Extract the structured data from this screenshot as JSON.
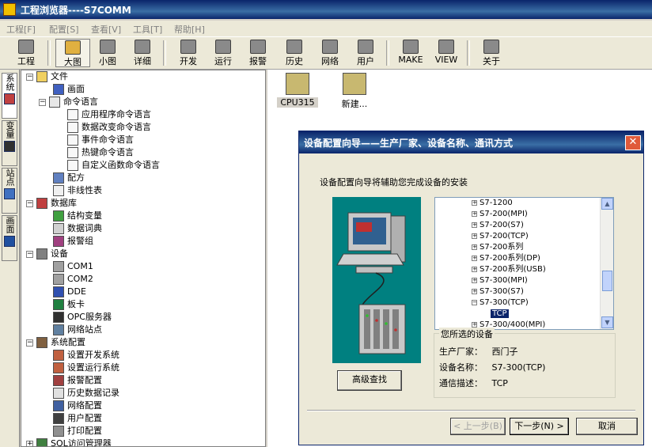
{
  "app": {
    "title": "工程浏览器----S7COMM"
  },
  "menu": [
    "工程[F]",
    "配置[S]",
    "查看[V]",
    "工具[T]",
    "帮助[H]"
  ],
  "toolbar": {
    "items": [
      {
        "label": "工程",
        "icon": "project-icon"
      },
      {
        "label": "大图",
        "icon": "large-icons-icon"
      },
      {
        "label": "小图",
        "icon": "small-icons-icon"
      },
      {
        "label": "详细",
        "icon": "details-icon"
      },
      {
        "label": "开发",
        "icon": "develop-icon"
      },
      {
        "label": "运行",
        "icon": "run-icon"
      },
      {
        "label": "报警",
        "icon": "alarm-icon"
      },
      {
        "label": "历史",
        "icon": "history-icon"
      },
      {
        "label": "网络",
        "icon": "network-icon"
      },
      {
        "label": "用户",
        "icon": "user-icon"
      },
      {
        "label": "MAKE",
        "icon": "make-icon"
      },
      {
        "label": "VIEW",
        "icon": "view-icon"
      },
      {
        "label": "关于",
        "icon": "about-icon"
      }
    ]
  },
  "side_tabs": [
    "系统",
    "变量",
    "站点",
    "画面"
  ],
  "tree": [
    {
      "label": "文件",
      "expander": "−",
      "icon": "folder-icon"
    },
    {
      "label": "画面",
      "icon": "screen-icon"
    },
    {
      "label": "命令语言",
      "expander": "−",
      "icon": "command-icon"
    },
    {
      "label": "应用程序命令语言",
      "icon": "doc-icon"
    },
    {
      "label": "数据改变命令语言",
      "icon": "doc-icon"
    },
    {
      "label": "事件命令语言",
      "icon": "doc-icon"
    },
    {
      "label": "热键命令语言",
      "icon": "doc-icon"
    },
    {
      "label": "自定义函数命令语言",
      "icon": "doc-icon"
    },
    {
      "label": "配方",
      "icon": "recipe-icon"
    },
    {
      "label": "非线性表",
      "icon": "table-icon"
    },
    {
      "label": "数据库",
      "expander": "−",
      "icon": "database-icon"
    },
    {
      "label": "结构变量",
      "icon": "struct-icon"
    },
    {
      "label": "数据词典",
      "icon": "dictionary-icon"
    },
    {
      "label": "报警组",
      "icon": "alarm-group-icon"
    },
    {
      "label": "设备",
      "expander": "−",
      "icon": "device-icon"
    },
    {
      "label": "COM1",
      "icon": "com-port-icon"
    },
    {
      "label": "COM2",
      "icon": "com-port-icon"
    },
    {
      "label": "DDE",
      "icon": "dde-icon"
    },
    {
      "label": "板卡",
      "icon": "board-icon"
    },
    {
      "label": "OPC服务器",
      "icon": "opc-icon"
    },
    {
      "label": "网络站点",
      "icon": "network-station-icon"
    },
    {
      "label": "系统配置",
      "expander": "−",
      "icon": "tools-icon"
    },
    {
      "label": "设置开发系统",
      "icon": "settings-icon"
    },
    {
      "label": "设置运行系统",
      "icon": "settings-icon"
    },
    {
      "label": "报警配置",
      "icon": "alarm-config-icon"
    },
    {
      "label": "历史数据记录",
      "icon": "history-record-icon"
    },
    {
      "label": "网络配置",
      "icon": "network-config-icon"
    },
    {
      "label": "用户配置",
      "icon": "user-config-icon"
    },
    {
      "label": "打印配置",
      "icon": "printer-icon"
    },
    {
      "label": "SQL访问管理器",
      "expander": "+",
      "icon": "sql-icon"
    }
  ],
  "content_icons": [
    {
      "label": "CPU315",
      "icon": "plc-device-icon"
    },
    {
      "label": "新建...",
      "icon": "new-device-icon"
    }
  ],
  "dialog": {
    "title": "设备配置向导——生产厂家、设备名称、通讯方式",
    "intro": "设备配置向导将辅助您完成设备的安装",
    "device_list": [
      "S7-1200",
      "S7-200(MPI)",
      "S7-200(S7)",
      "S7-200(TCP)",
      "S7-200系列",
      "S7-200系列(DP)",
      "S7-200系列(USB)",
      "S7-300(MPI)",
      "S7-300(S7)",
      "S7-300(TCP)",
      "TCP",
      "S7-300/400(MPI)"
    ],
    "selected_group": {
      "title": "您所选的设备",
      "manufacturer_label": "生产厂家：",
      "manufacturer": "西门子",
      "device_label": "设备名称：",
      "device": "S7-300(TCP)",
      "comm_label": "通信描述：",
      "comm": "TCP"
    },
    "advanced_button": "高级查找",
    "prev_button": "< 上一步(B)",
    "next_button": "下一步(N) >",
    "cancel_button": "取消",
    "accent": "#0a246a",
    "illustration_bg": "#008080"
  }
}
